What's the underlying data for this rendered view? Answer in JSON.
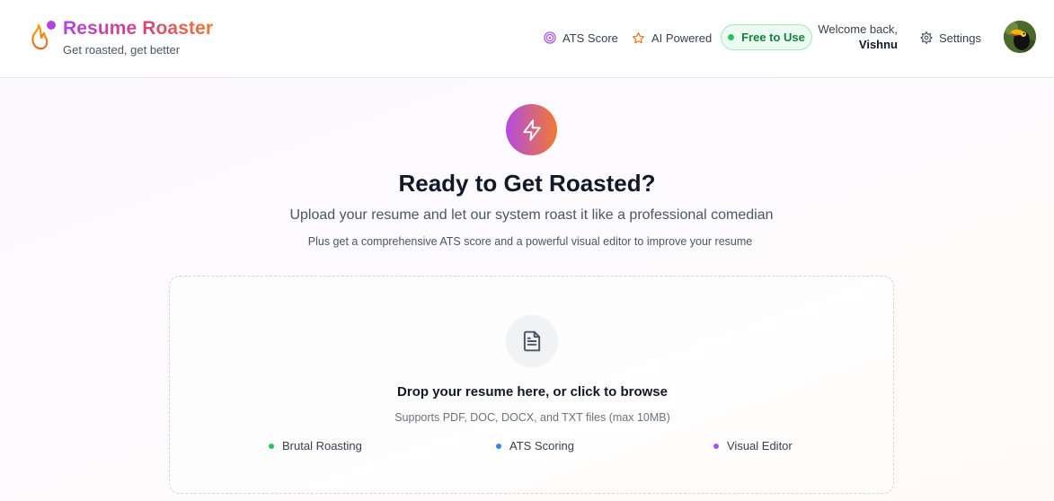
{
  "brand": {
    "title": "Resume Roaster",
    "subtitle": "Get roasted, get better",
    "icon": "flame-icon"
  },
  "nav": {
    "ats_score": {
      "label": "ATS Score",
      "icon": "target-icon"
    },
    "ai_powered": {
      "label": "AI Powered",
      "icon": "star-icon"
    },
    "free_badge": "Free to Use",
    "welcome_line": "Welcome back,",
    "user_name": "Vishnu",
    "settings": {
      "label": "Settings",
      "icon": "gear-icon"
    }
  },
  "hero": {
    "icon": "lightning-icon",
    "title": "Ready to Get Roasted?",
    "subtitle": "Upload your resume and let our system roast it like a professional comedian",
    "note": "Plus get a comprehensive ATS score and a powerful visual editor to improve your resume"
  },
  "upload": {
    "icon": "document-icon",
    "title": "Drop your resume here, or click to browse",
    "supported": "Supports PDF, DOC, DOCX, and TXT files (max 10MB)",
    "features": [
      {
        "label": "Brutal Roasting",
        "color": "#22c55e"
      },
      {
        "label": "ATS Scoring",
        "color": "#3b82f6"
      },
      {
        "label": "Visual Editor",
        "color": "#a855f7"
      }
    ]
  },
  "colors": {
    "brand_purple": "#b145e0",
    "brand_orange": "#f07a33",
    "success_green": "#22c55e"
  }
}
